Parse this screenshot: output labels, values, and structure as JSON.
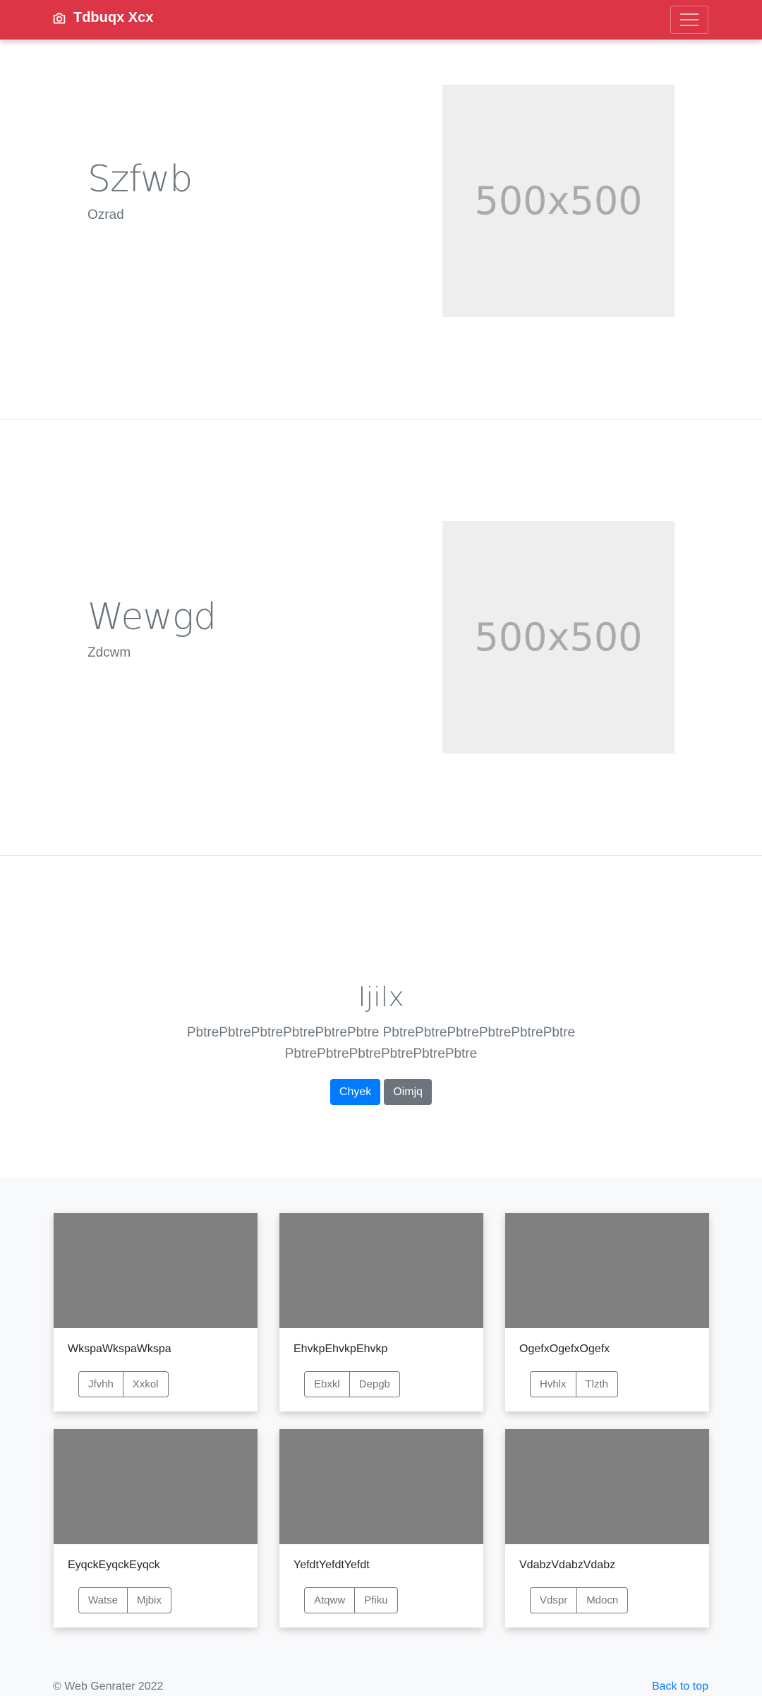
{
  "navbar": {
    "brand": "Tdbuqx Xcx",
    "brand_icon": "camera-icon",
    "toggler_icon": "hamburger-menu-icon",
    "color": "#dc3545"
  },
  "features": [
    {
      "title": "Szfwb",
      "subtitle": "Ozrad",
      "image_label": "500x500"
    },
    {
      "title": "Wewgd",
      "subtitle": "Zdcwm",
      "image_label": "500x500"
    }
  ],
  "jumbotron": {
    "title": "Ijilx",
    "lead": "PbtrePbtrePbtrePbtrePbtrePbtre PbtrePbtrePbtrePbtrePbtrePbtre PbtrePbtrePbtrePbtrePbtrePbtre",
    "primary_button": "Chyek",
    "secondary_button": "Oimjq"
  },
  "cards": [
    {
      "text": "WkspaWkspaWkspa",
      "buttons": [
        "Jfvhh",
        "Xxkol"
      ]
    },
    {
      "text": "EhvkpEhvkpEhvkp",
      "buttons": [
        "Ebxkl",
        "Depgb"
      ]
    },
    {
      "text": "OgefxOgefxOgefx",
      "buttons": [
        "Hvhlx",
        "Tlzth"
      ]
    },
    {
      "text": "EyqckEyqckEyqck",
      "buttons": [
        "Watse",
        "Mjbix"
      ]
    },
    {
      "text": "YefdtYefdtYefdt",
      "buttons": [
        "Atqww",
        "Pfiku"
      ]
    },
    {
      "text": "VdabzVdabzVdabz",
      "buttons": [
        "Vdspr",
        "Mdocn"
      ]
    }
  ],
  "footer": {
    "copyright": "© Web Genrater 2022",
    "back_to_top": "Back to top"
  }
}
